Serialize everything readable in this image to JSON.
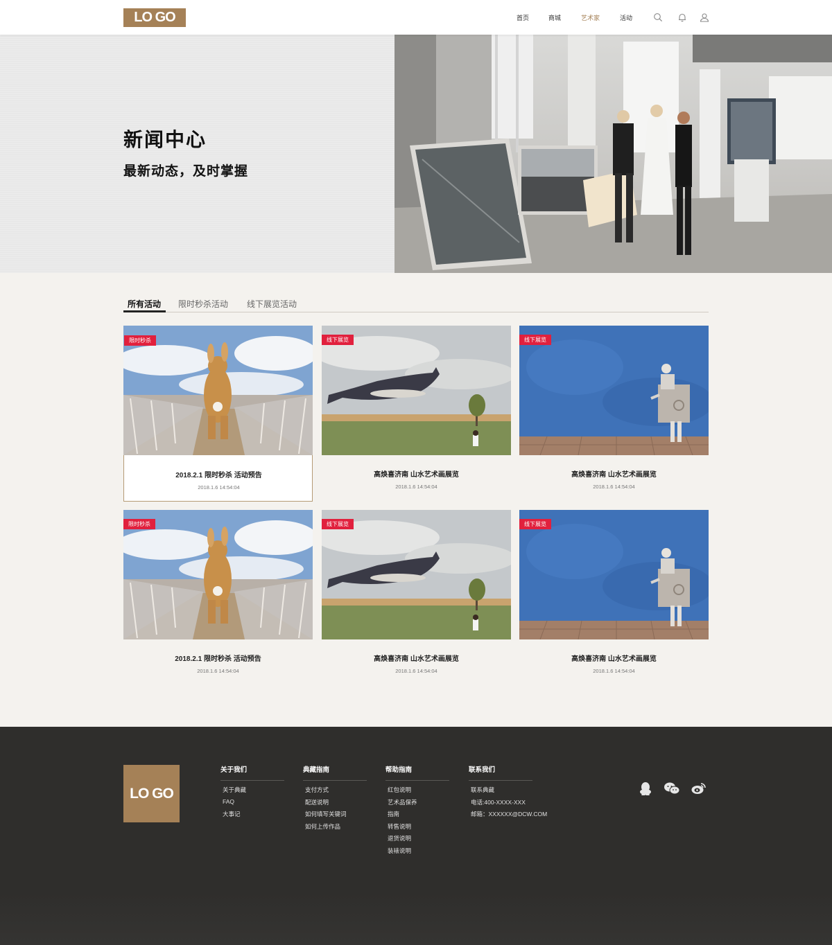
{
  "header": {
    "logo": "LO GO",
    "nav": [
      "首页",
      "商城",
      "艺术家",
      "活动"
    ],
    "active_nav_index": 2,
    "icons": [
      "search-icon",
      "bell-icon",
      "user-icon"
    ]
  },
  "hero": {
    "title": "新闻中心",
    "subtitle": "最新动态，及时掌握"
  },
  "tabs": {
    "items": [
      "所有活动",
      "限时秒杀活动",
      "线下展览活动"
    ],
    "active_index": 0
  },
  "cards": [
    {
      "badge": "限时秒杀",
      "title": "2018.2.1 限时秒杀  活动预告",
      "date": "2018.1.6    14:54:04",
      "image": "rabbit-bridge"
    },
    {
      "badge": "线下展览",
      "title": "高焕喜济南  山水艺术画展览",
      "date": "2018.1.6    14:54:04",
      "image": "whale-sky"
    },
    {
      "badge": "线下展览",
      "title": "高焕喜济南  山水艺术画展览",
      "date": "2018.1.6    14:54:04",
      "image": "robot-blue-wall"
    },
    {
      "badge": "限时秒杀",
      "title": "2018.2.1 限时秒杀  活动预告",
      "date": "2018.1.6    14:54:04",
      "image": "rabbit-bridge"
    },
    {
      "badge": "线下展览",
      "title": "高焕喜济南  山水艺术画展览",
      "date": "2018.1.6    14:54:04",
      "image": "whale-sky"
    },
    {
      "badge": "线下展览",
      "title": "高焕喜济南  山水艺术画展览",
      "date": "2018.1.6    14:54:04",
      "image": "robot-blue-wall"
    }
  ],
  "footer": {
    "logo": "LO GO",
    "columns": [
      {
        "title": "关于我们",
        "items": [
          "关于典藏",
          "FAQ",
          "大事记"
        ]
      },
      {
        "title": "典藏指南",
        "items": [
          "支付方式",
          "配送说明",
          "如何填写关键词",
          "如何上传作品"
        ]
      },
      {
        "title": "帮助指南",
        "items": [
          "红包说明",
          "艺术品保养",
          "指南",
          "转售说明",
          "退货说明",
          "装裱说明"
        ]
      },
      {
        "title": "联系我们",
        "items": [
          "联系典藏",
          "电话:400-XXXX-XXX",
          "邮箱：XXXXXX@DCW.COM"
        ]
      }
    ],
    "social_icons": [
      "qq-icon",
      "wechat-icon",
      "weibo-icon"
    ]
  },
  "colors": {
    "brand": "#a58157",
    "badge_red": "#e1203d",
    "footer_bg": "#2f2e2c",
    "page_bg": "#f4f2ee"
  }
}
